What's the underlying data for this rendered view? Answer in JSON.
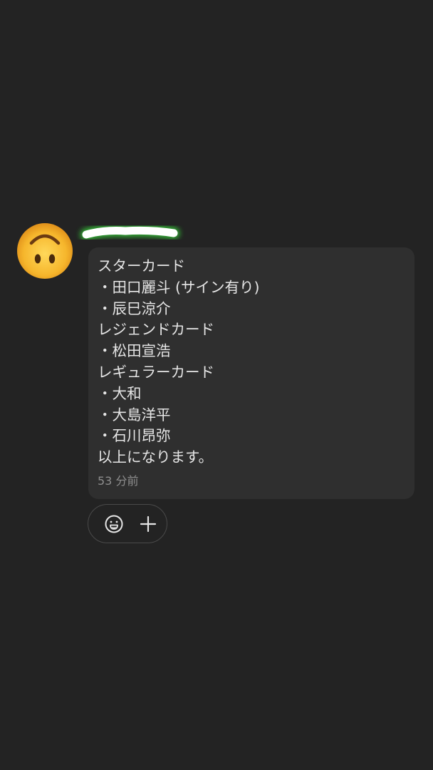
{
  "sender": {
    "avatar_icon": "upside-down-face-emoji-icon",
    "name_state": "redacted"
  },
  "message": {
    "lines": [
      "スターカード",
      "・田口麗斗 (サイン有り)",
      "・辰巳涼介",
      "レジェンドカード",
      "・松田宣浩",
      "レギュラーカード",
      "・大和",
      "・大島洋平",
      "・石川昂弥",
      "以上になります。"
    ],
    "timestamp": "53 分前"
  },
  "reactions": {
    "emoji_icon": "smiley-face-icon",
    "add_icon": "plus-icon"
  },
  "colors": {
    "background": "#232323",
    "bubble": "#2f2f2f",
    "text": "#e6e6e6",
    "muted": "#8e8e8e",
    "redaction_glow": "#39d43a"
  }
}
